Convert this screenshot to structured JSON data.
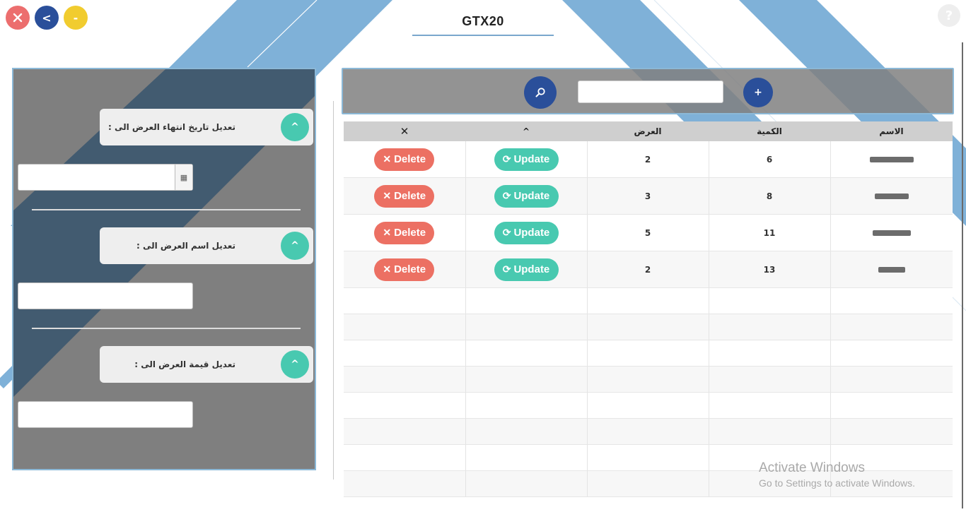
{
  "window": {
    "close_icon": "close-icon",
    "back_label": "<",
    "min_label": "-",
    "help_label": "?"
  },
  "title": "GTX20",
  "left_panel": {
    "fields": [
      {
        "label": "تعديل تاريخ انتهاء العرض الى :",
        "toggle": "^",
        "value": "",
        "type": "date"
      },
      {
        "label": "تعديل اسم العرض الى :",
        "toggle": "^",
        "value": "",
        "type": "text"
      },
      {
        "label": "تعديل قيمة العرض الى :",
        "toggle": "^",
        "value": "",
        "type": "text"
      }
    ],
    "date_picker_icon": "▦"
  },
  "toolbar": {
    "search_icon": "⚲",
    "search_value": "",
    "add_label": "+"
  },
  "table": {
    "headers": {
      "actions_delete": "✕",
      "actions_update": "^",
      "offer": "العرض",
      "quantity": "الكمية",
      "name": "الاسم"
    },
    "delete_label": "Delete",
    "update_label": "Update",
    "rows": [
      {
        "offer": "2",
        "quantity": "6"
      },
      {
        "offer": "3",
        "quantity": "8"
      },
      {
        "offer": "5",
        "quantity": "11"
      },
      {
        "offer": "2",
        "quantity": "13"
      }
    ]
  },
  "watermark": {
    "title": "Activate Windows",
    "subtitle": "Go to Settings to activate Windows."
  },
  "colors": {
    "danger": "#ec7063",
    "success": "#48c9b0",
    "primary": "#2a4f9a",
    "warning": "#f1cc2f",
    "stripe": "#7fb1d8"
  }
}
